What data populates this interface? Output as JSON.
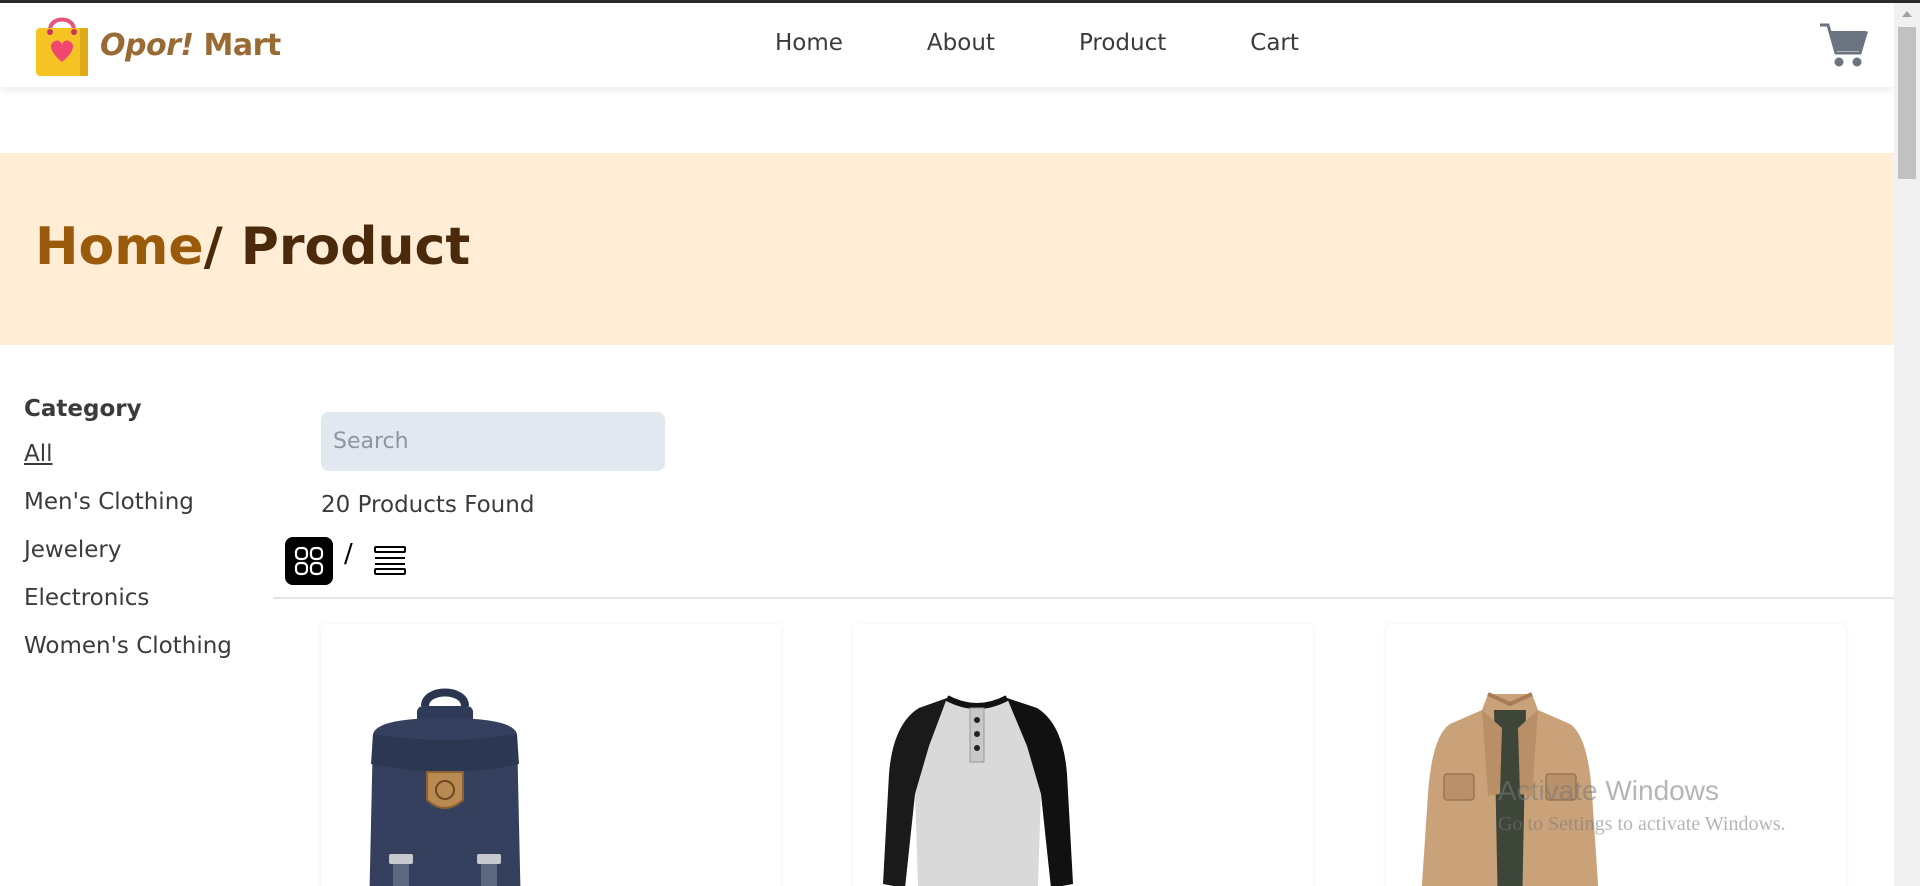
{
  "brand": {
    "name_italic": "Opor!",
    "name_rest": "Mart"
  },
  "nav": {
    "items": [
      {
        "label": "Home"
      },
      {
        "label": "About"
      },
      {
        "label": "Product"
      },
      {
        "label": "Cart"
      }
    ]
  },
  "hero": {
    "home_label": "Home",
    "current_label": "/ Product"
  },
  "sidebar": {
    "title": "Category",
    "items": [
      {
        "label": "All",
        "active": true
      },
      {
        "label": "Men's Clothing"
      },
      {
        "label": "Jewelery"
      },
      {
        "label": "Electronics"
      },
      {
        "label": "Women's Clothing"
      }
    ]
  },
  "toolbar": {
    "search_placeholder": "Search",
    "products_found": "20 Products Found",
    "view_separator": "/"
  },
  "products": [
    {
      "image": "navy-backpack"
    },
    {
      "image": "raglan-henley-shirt"
    },
    {
      "image": "beige-jacket"
    }
  ],
  "watermark": {
    "title": "Activate Windows",
    "subtitle": "Go to Settings to activate Windows."
  },
  "colors": {
    "brand": "#9a6a35",
    "hero_bg": "#ffedd5",
    "breadcrumb_home": "#9a5a0c",
    "breadcrumb_current": "#4a2a0a",
    "search_bg": "#e2e8f0",
    "cart_icon": "#6b7280"
  }
}
